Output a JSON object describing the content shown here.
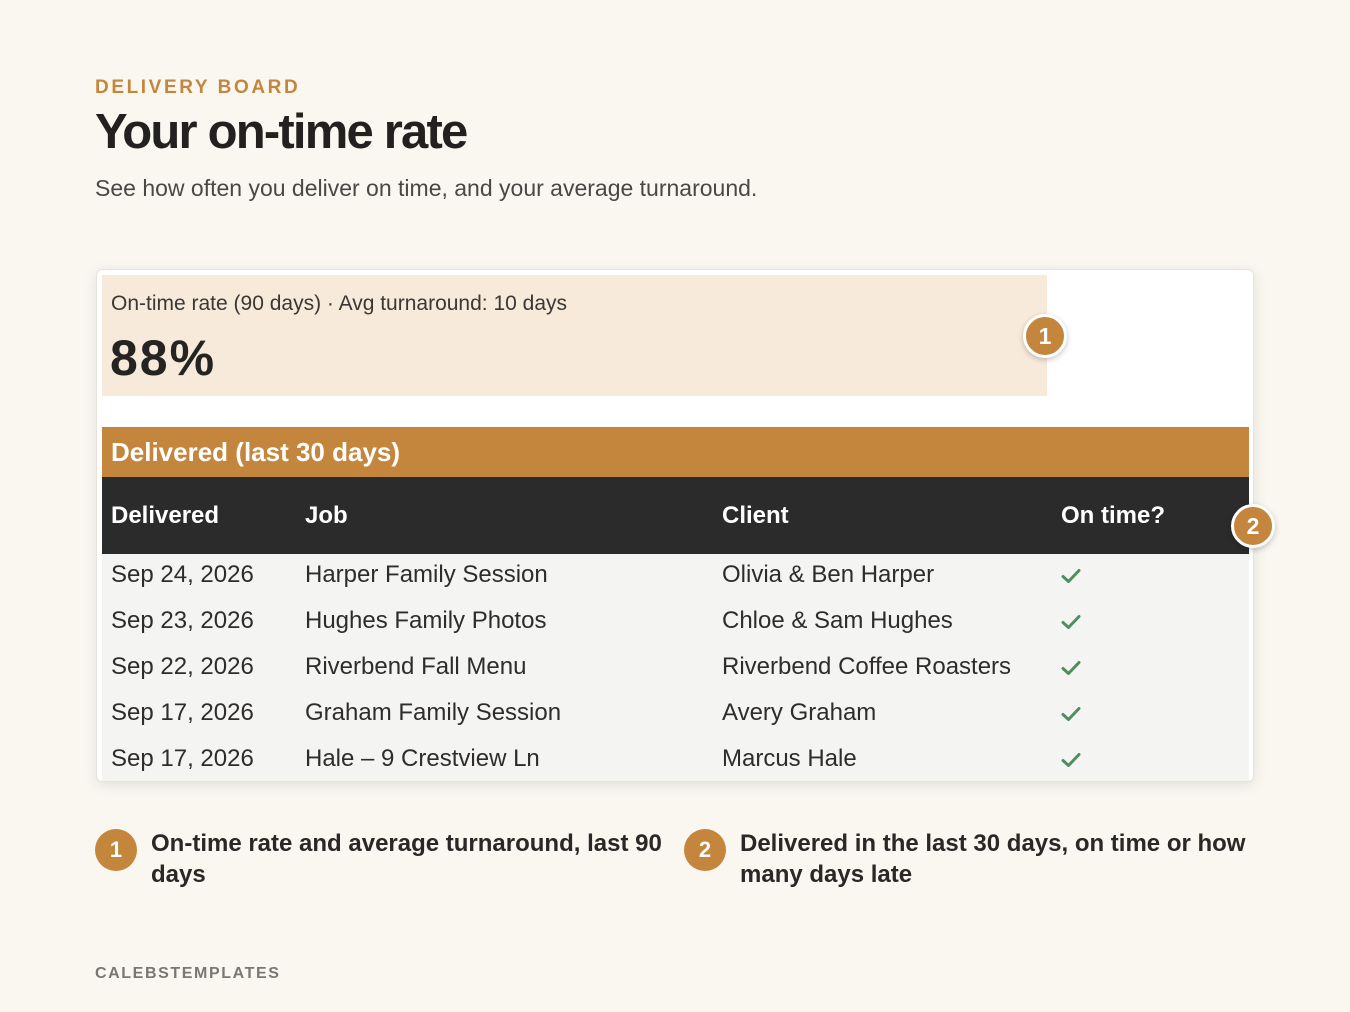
{
  "header": {
    "eyebrow": "DELIVERY BOARD",
    "title": "Your on-time rate",
    "subtitle": "See how often you deliver on time, and your average turnaround."
  },
  "stat": {
    "label": "On-time rate (90 days) · Avg turnaround: 10 days",
    "value": "88%"
  },
  "table": {
    "title": "Delivered (last 30 days)",
    "columns": [
      "Delivered",
      "Job",
      "Client",
      "On time?"
    ],
    "rows": [
      {
        "delivered": "Sep 24, 2026",
        "job": "Harper Family Session",
        "client": "Olivia & Ben Harper",
        "on_time": true
      },
      {
        "delivered": "Sep 23, 2026",
        "job": "Hughes Family Photos",
        "client": "Chloe & Sam Hughes",
        "on_time": true
      },
      {
        "delivered": "Sep 22, 2026",
        "job": "Riverbend Fall Menu",
        "client": "Riverbend Coffee Roasters",
        "on_time": true
      },
      {
        "delivered": "Sep 17, 2026",
        "job": "Graham Family Session",
        "client": "Avery Graham",
        "on_time": true
      },
      {
        "delivered": "Sep 17, 2026",
        "job": "Hale – 9 Crestview Ln",
        "client": "Marcus Hale",
        "on_time": true
      }
    ],
    "check_icon": "check-icon"
  },
  "callouts": [
    {
      "number": "1",
      "text": "On-time rate and average turnaround, last 90 days"
    },
    {
      "number": "2",
      "text": "Delivered in the last 30 days, on time or how many days late"
    }
  ],
  "footer": "CALEBSTEMPLATES",
  "colors": {
    "accent": "#c4863c",
    "stat_bg": "#f7eadb",
    "table_header": "#2b2b2b",
    "check": "#4f8f5b",
    "page_bg": "#faf7f1"
  }
}
